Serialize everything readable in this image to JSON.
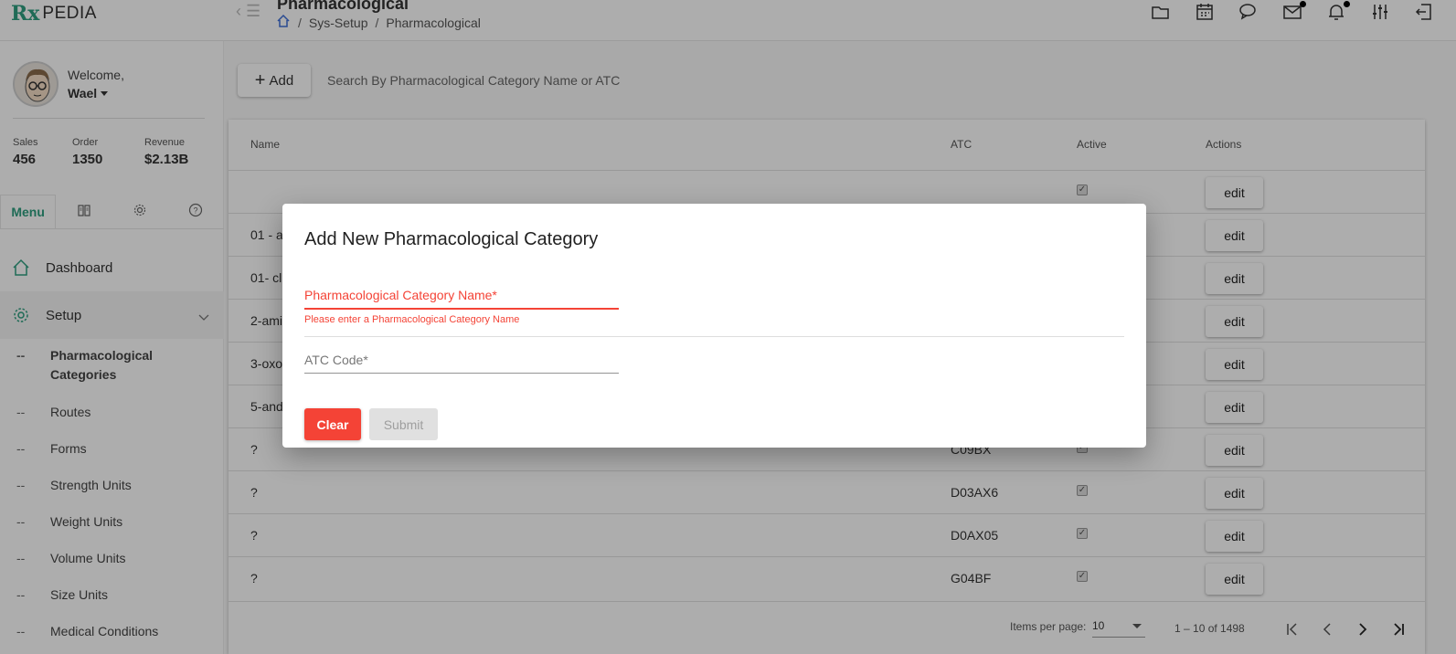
{
  "header": {
    "logo_rx": "Rx",
    "logo_text": "PEDIA",
    "page_title": "Pharmacological",
    "breadcrumb": [
      "Sys-Setup",
      "Pharmacological"
    ],
    "icons": [
      "folder-icon",
      "calendar-icon",
      "chat-icon",
      "mail-icon",
      "bell-icon",
      "sliders-icon",
      "logout-icon"
    ]
  },
  "sidebar": {
    "welcome": "Welcome,",
    "user_name": "Wael",
    "stats": [
      {
        "label": "Sales",
        "value": "456"
      },
      {
        "label": "Order",
        "value": "1350"
      },
      {
        "label": "Revenue",
        "value": "$2.13B"
      }
    ],
    "menu_tab": "Menu",
    "nav": {
      "dashboard": "Dashboard",
      "setup": "Setup"
    },
    "sub_items": [
      "Pharmacological Categories",
      "Routes",
      "Forms",
      "Strength Units",
      "Weight Units",
      "Volume Units",
      "Size Units",
      "Medical Conditions"
    ],
    "dash": "--"
  },
  "toolbar": {
    "add_label": "Add",
    "search_placeholder": "Search By Pharmacological Category Name or ATC"
  },
  "table": {
    "columns": [
      "Name",
      "ATC",
      "Active",
      "Actions"
    ],
    "rows": [
      {
        "name": "",
        "atc": "",
        "active": true
      },
      {
        "name": "01 - a",
        "atc": "",
        "active": true
      },
      {
        "name": "01- cl",
        "atc": "",
        "active": true
      },
      {
        "name": "2-ami",
        "atc": "",
        "active": true
      },
      {
        "name": "3-oxo",
        "atc": "",
        "active": true
      },
      {
        "name": "5-and",
        "atc": "",
        "active": true
      },
      {
        "name": "?",
        "atc": "C09BX",
        "active": true
      },
      {
        "name": "?",
        "atc": "D03AX6",
        "active": true
      },
      {
        "name": "?",
        "atc": "D0AX05",
        "active": true
      },
      {
        "name": "?",
        "atc": "G04BF",
        "active": true
      }
    ],
    "edit_label": "edit",
    "paginator": {
      "items_per_page_label": "Items per page:",
      "page_size": "10",
      "range": "1 – 10 of 1498"
    }
  },
  "dialog": {
    "title": "Add New Pharmacological Category",
    "name_label": "Pharmacological Category Name*",
    "name_error": "Please enter a Pharmacological Category Name",
    "atc_label": "ATC Code*",
    "clear_label": "Clear",
    "submit_label": "Submit"
  },
  "colors": {
    "brand": "#2e9e7f",
    "error": "#f44336",
    "overlay": "rgba(0,0,0,0.32)"
  }
}
